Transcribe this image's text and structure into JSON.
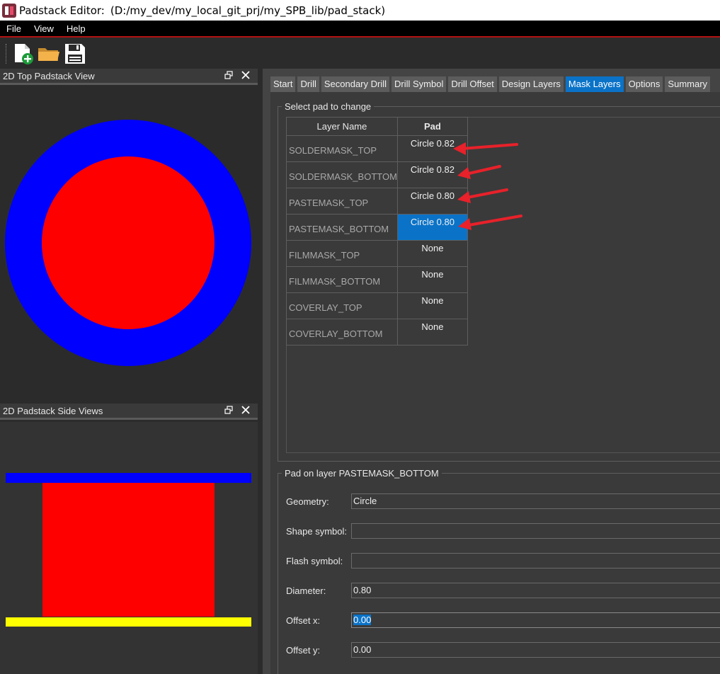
{
  "window": {
    "app_title": "Padstack Editor:",
    "path": "(D:/my_dev/my_local_git_prj/my_SPB_lib/pad_stack)"
  },
  "menu": [
    "File",
    "View",
    "Help"
  ],
  "toolbar": {
    "icons": [
      "new-file-icon",
      "open-folder-icon",
      "save-icon"
    ]
  },
  "top_view": {
    "title": "2D Top Padstack View",
    "outer_color": "#0000ff",
    "inner_color": "#ff0000"
  },
  "side_view": {
    "title": "2D Padstack Side Views",
    "top_bar_color": "#0000ff",
    "body_color": "#ff0000",
    "bottom_bar_color": "#ffff00"
  },
  "tabs": [
    {
      "label": "Start",
      "active": false
    },
    {
      "label": "Drill",
      "active": false
    },
    {
      "label": "Secondary Drill",
      "active": false
    },
    {
      "label": "Drill Symbol",
      "active": false
    },
    {
      "label": "Drill Offset",
      "active": false
    },
    {
      "label": "Design Layers",
      "active": false
    },
    {
      "label": "Mask Layers",
      "active": true
    },
    {
      "label": "Options",
      "active": false
    },
    {
      "label": "Summary",
      "active": false
    }
  ],
  "select_group": {
    "title": "Select pad to change",
    "columns": [
      "Layer Name",
      "Pad"
    ],
    "rows": [
      {
        "layer": "SOLDERMASK_TOP",
        "pad": "Circle 0.82",
        "selected": false
      },
      {
        "layer": "SOLDERMASK_BOTTOM",
        "pad": "Circle 0.82",
        "selected": false
      },
      {
        "layer": "PASTEMASK_TOP",
        "pad": "Circle 0.80",
        "selected": false
      },
      {
        "layer": "PASTEMASK_BOTTOM",
        "pad": "Circle 0.80",
        "selected": true
      },
      {
        "layer": "FILMMASK_TOP",
        "pad": "None",
        "selected": false
      },
      {
        "layer": "FILMMASK_BOTTOM",
        "pad": "None",
        "selected": false
      },
      {
        "layer": "COVERLAY_TOP",
        "pad": "None",
        "selected": false
      },
      {
        "layer": "COVERLAY_BOTTOM",
        "pad": "None",
        "selected": false
      }
    ]
  },
  "pad_group": {
    "title": "Pad on layer PASTEMASK_BOTTOM",
    "fields": [
      {
        "label": "Geometry:",
        "value": "Circle"
      },
      {
        "label": "Shape symbol:",
        "value": ""
      },
      {
        "label": "Flash symbol:",
        "value": ""
      },
      {
        "label": "Diameter:",
        "value": "0.80"
      },
      {
        "label": "Offset x:",
        "value": "0.00"
      },
      {
        "label": "Offset y:",
        "value": "0.00"
      }
    ]
  },
  "annotation_color": "#e8212a"
}
